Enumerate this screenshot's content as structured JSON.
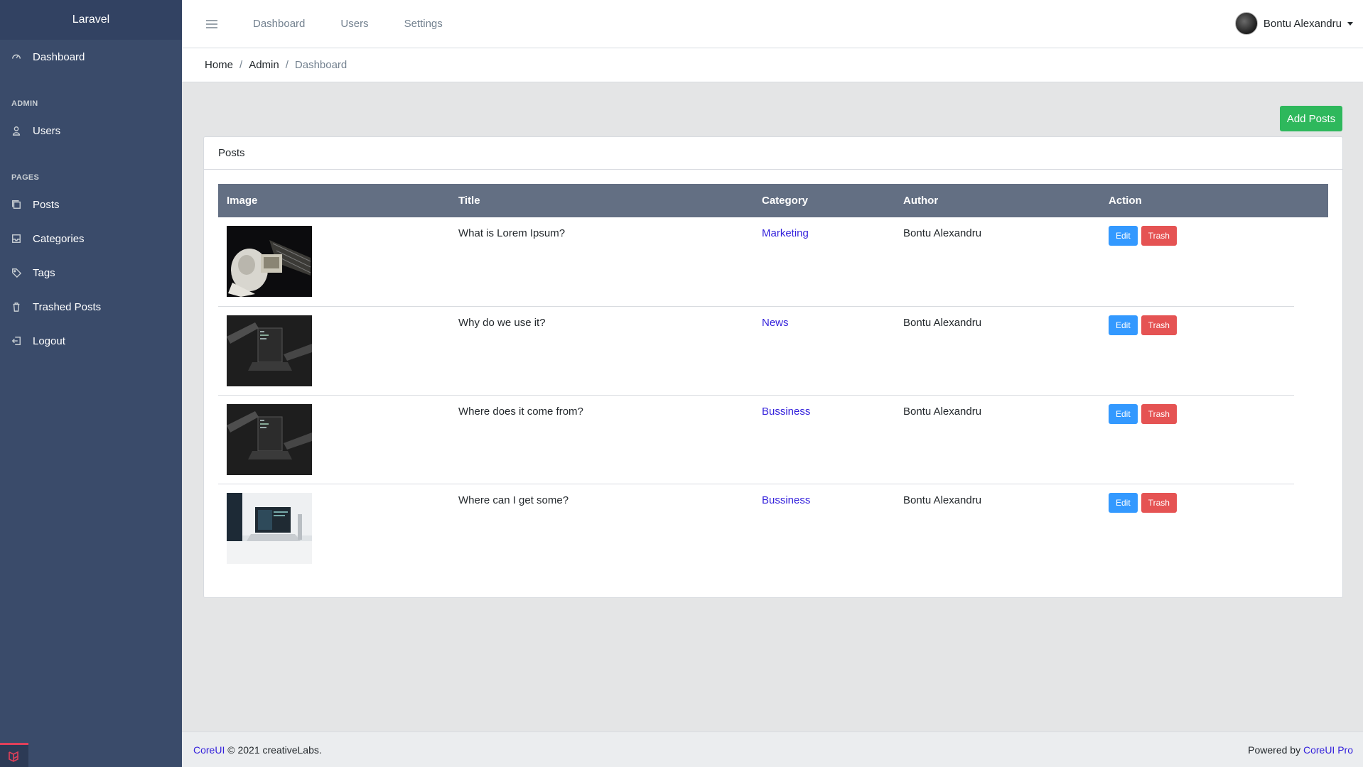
{
  "sidebar": {
    "brand": "Laravel",
    "items": [
      {
        "label": "Dashboard",
        "icon": "speedometer-icon"
      },
      {
        "section": "ADMIN"
      },
      {
        "label": "Users",
        "icon": "user-icon"
      },
      {
        "section": "PAGES"
      },
      {
        "label": "Posts",
        "icon": "copy-icon"
      },
      {
        "label": "Categories",
        "icon": "inbox-icon"
      },
      {
        "label": "Tags",
        "icon": "tag-icon"
      },
      {
        "label": "Trashed Posts",
        "icon": "trash-icon"
      },
      {
        "label": "Logout",
        "icon": "logout-icon"
      }
    ]
  },
  "header": {
    "links": [
      "Dashboard",
      "Users",
      "Settings"
    ],
    "user_name": "Bontu Alexandru"
  },
  "breadcrumb": {
    "items": [
      "Home",
      "Admin",
      "Dashboard"
    ]
  },
  "main": {
    "add_button": "Add Posts",
    "card_title": "Posts",
    "columns": [
      "Image",
      "Title",
      "Category",
      "Author",
      "Action"
    ],
    "rows": [
      {
        "title": "What is Lorem Ipsum?",
        "category": "Marketing",
        "author": "Bontu Alexandru",
        "edit": "Edit",
        "trash": "Trash",
        "image": "astronaut-satellite-image"
      },
      {
        "title": "Why do we use it?",
        "category": "News",
        "author": "Bontu Alexandru",
        "edit": "Edit",
        "trash": "Trash",
        "image": "dark-laptop-image"
      },
      {
        "title": "Where does it come from?",
        "category": "Bussiness",
        "author": "Bontu Alexandru",
        "edit": "Edit",
        "trash": "Trash",
        "image": "dark-laptop-image"
      },
      {
        "title": "Where can I get some?",
        "category": "Bussiness",
        "author": "Bontu Alexandru",
        "edit": "Edit",
        "trash": "Trash",
        "image": "desk-laptop-image"
      }
    ]
  },
  "footer": {
    "brand_link": "CoreUI",
    "copyright": "© 2021 creativeLabs.",
    "powered_prefix": "Powered by",
    "powered_link": "CoreUI Pro"
  },
  "colors": {
    "sidebar": "#3a4b6a",
    "table_header": "#636f83",
    "success": "#2eb85c",
    "info": "#3399ff",
    "danger": "#e55353",
    "link": "#321fdb"
  }
}
